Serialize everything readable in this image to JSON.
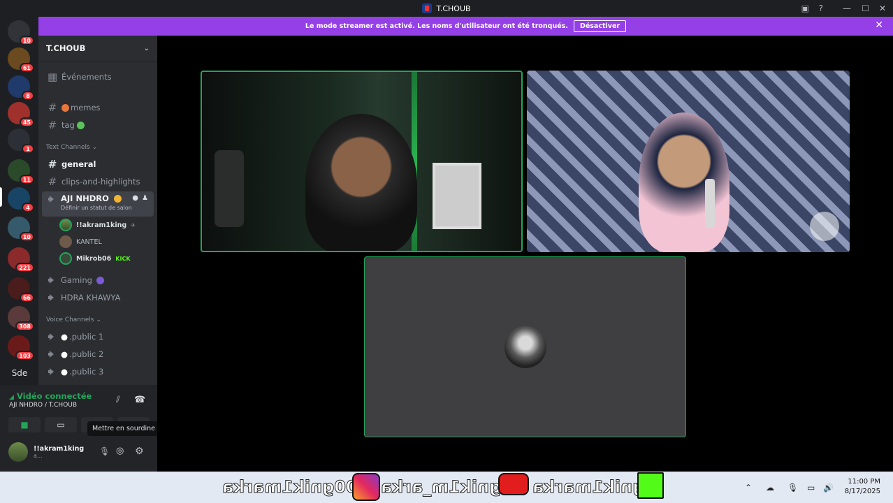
{
  "window": {
    "title": "T.CHOUB"
  },
  "banner": {
    "text": "Le mode streamer est activé. Les noms d'utilisateur ont été tronqués.",
    "button": "Désactiver"
  },
  "servers": [
    {
      "badge": "10"
    },
    {
      "badge": "61"
    },
    {
      "badge": "8"
    },
    {
      "badge": "45"
    },
    {
      "badge": "1"
    },
    {
      "badge": "11"
    },
    {
      "badge": "4"
    },
    {
      "badge": "10"
    },
    {
      "badge": "221"
    },
    {
      "badge": "66"
    },
    {
      "badge": "308"
    },
    {
      "badge": "103"
    }
  ],
  "server_text": "Sde",
  "guild": {
    "name": "T.CHOUB"
  },
  "channels": {
    "events": "Événements",
    "memes": "memes",
    "tag": "tag",
    "cat_text": "Text Channels",
    "general": "general",
    "clips": "clips-and-highlights",
    "voice_active": "AJI NHDRO",
    "voice_active_status": "Définir un statut de salon",
    "members": [
      {
        "name": "!!akram1king"
      },
      {
        "name": "KANTEL"
      },
      {
        "name": "Mikrob06",
        "tag": "KICK"
      }
    ],
    "gaming": "Gaming",
    "hdra": "HDRA KHAWYA",
    "cat_voice": "Voice Channels",
    "public1": ".public 1",
    "public2": ".public 2",
    "public3": ".public 3"
  },
  "panel": {
    "connected": "Vidéo connectée",
    "location": "AJI NHDRO / T.CHOUB",
    "username": "!!akram1king",
    "user_status": "a..."
  },
  "tooltip": "Mettre en sourdine",
  "taskbar": {
    "mirrored_text_1": "00gnik1marka",
    "mirrored_text_2": "gnik1m_arka",
    "mirrored_text_3": "gnik1marka",
    "time": "11:00 PM",
    "date": "8/17/2025"
  }
}
